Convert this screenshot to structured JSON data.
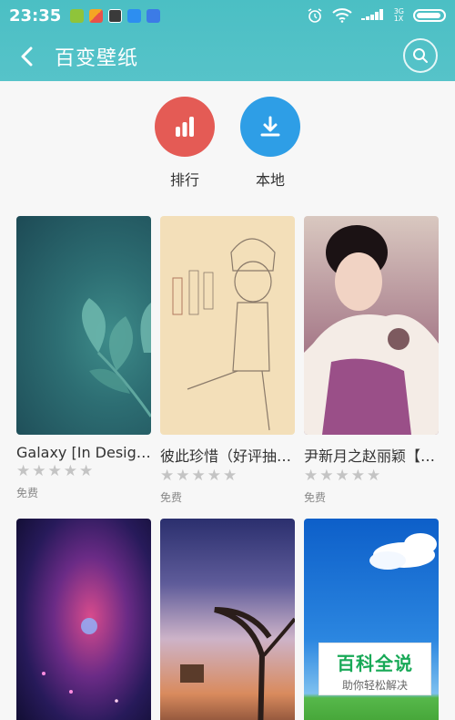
{
  "status": {
    "time": "23:35",
    "net_top": "3G",
    "net_bottom": "1X"
  },
  "header": {
    "title": "百变壁纸"
  },
  "quick_actions": [
    {
      "label": "排行",
      "color": "#e45b55"
    },
    {
      "label": "本地",
      "color": "#2e9ee6"
    }
  ],
  "wallpapers": [
    {
      "name": "Galaxy [In Design]",
      "stars": "★★★★★",
      "price": "免费"
    },
    {
      "name": "彼此珍惜（好评抽…",
      "stars": "★★★★★",
      "price": "免费"
    },
    {
      "name": "尹新月之赵丽颖【…",
      "stars": "★★★★★",
      "price": "免费"
    }
  ],
  "watermark": {
    "title": "百科全说",
    "subtitle": "助你轻松解决"
  },
  "colors": {
    "header": "#4bbfc4",
    "background": "#f7f7f7"
  }
}
